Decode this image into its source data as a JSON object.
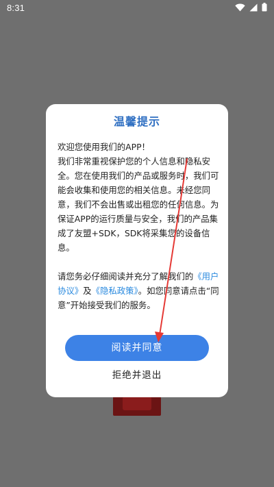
{
  "status_bar": {
    "time": "8:31"
  },
  "dialog": {
    "title": "温馨提示",
    "greeting": "欢迎您使用我们的APP！",
    "paragraph1": "我们非常重视保护您的个人信息和隐私安全。您在使用我们的产品或服务时，我们可能会收集和使用您的相关信息。未经您同意，我们不会出售或出租您的任何信息。为保证APP的运行质量与安全，我们的产品集成了友盟+SDK，SDK将采集您的设备信息。",
    "paragraph2_before": "请您务必仔细阅读并充分了解我们的",
    "user_agreement_link": "《用户协议》",
    "conjunction": "及",
    "privacy_policy_link": "《隐私政策》",
    "paragraph2_after": "。如您同意请点击“同意”开始接受我们的服务。",
    "agree_label": "阅读并同意",
    "refuse_label": "拒绝并退出"
  },
  "colors": {
    "title": "#2f6fc2",
    "link": "#2a8adf",
    "primary_button": "#3d82e6",
    "annotation_arrow": "#e53935",
    "overlay": "#6f6f6f"
  },
  "icons": {
    "status": [
      "wifi-icon",
      "signal-icon",
      "battery-icon"
    ],
    "annotation": "red-arrow-annotation"
  }
}
